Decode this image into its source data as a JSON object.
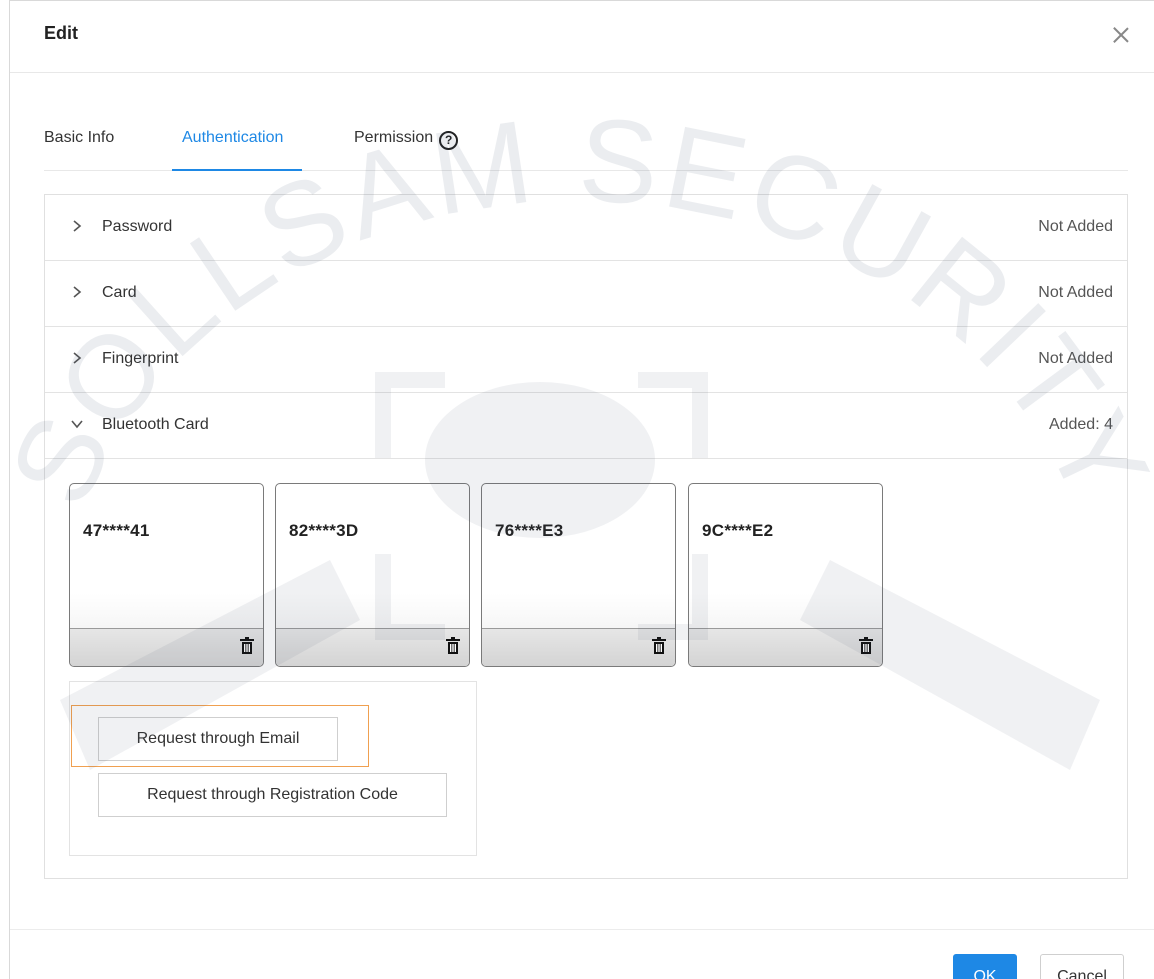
{
  "dialog": {
    "title": "Edit"
  },
  "tabs": [
    {
      "label": "Basic Info",
      "active": false
    },
    {
      "label": "Authentication",
      "active": true
    },
    {
      "label": "Permission",
      "active": false
    }
  ],
  "auth_rows": [
    {
      "label": "Password",
      "status": "Not Added",
      "expanded": false
    },
    {
      "label": "Card",
      "status": "Not Added",
      "expanded": false
    },
    {
      "label": "Fingerprint",
      "status": "Not Added",
      "expanded": false
    },
    {
      "label": "Bluetooth Card",
      "status": "Added: 4",
      "expanded": true
    }
  ],
  "bluetooth_cards": [
    {
      "id": "47****41"
    },
    {
      "id": "82****3D"
    },
    {
      "id": "76****E3"
    },
    {
      "id": "9C****E2"
    }
  ],
  "request": {
    "email_label": "Request through Email",
    "code_label": "Request through Registration Code"
  },
  "footer": {
    "ok_label": "OK",
    "cancel_label": "Cancel"
  },
  "watermark": {
    "text": "SOLLSAM SECURITY"
  },
  "colors": {
    "accent": "#1e88e5",
    "highlight": "#f0a050"
  }
}
